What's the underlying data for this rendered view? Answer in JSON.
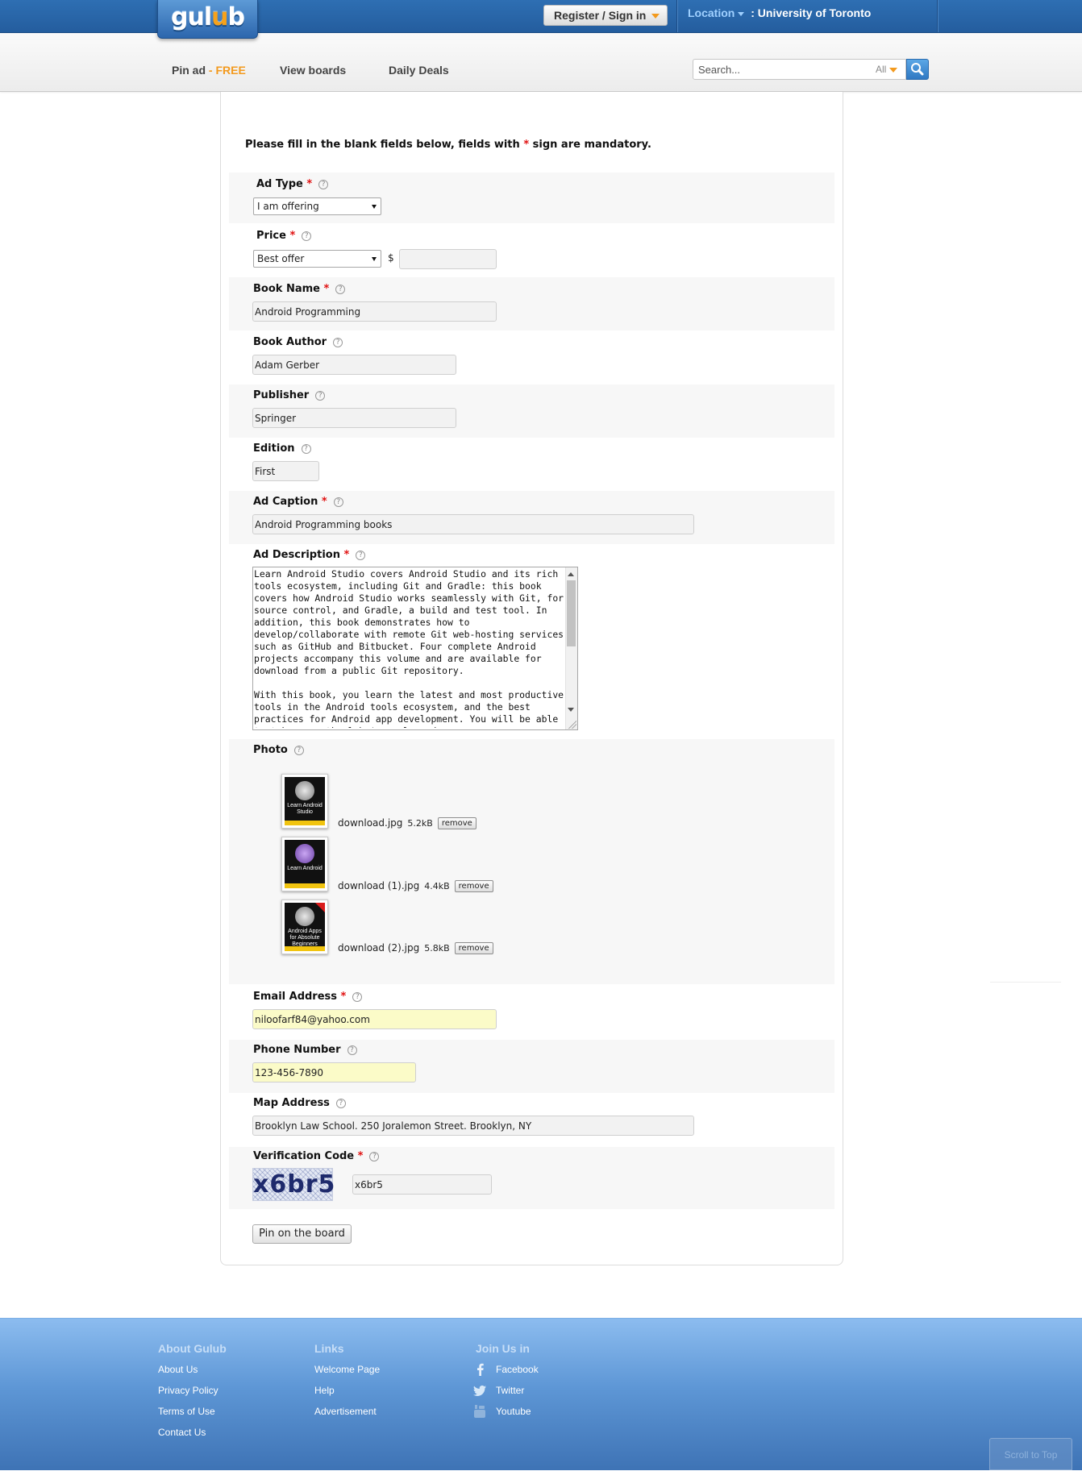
{
  "header": {
    "logo": "gulub",
    "register_label": "Register / Sign in",
    "location_label": "Location",
    "location_value": ": University of Toronto"
  },
  "nav": {
    "pin_ad": "Pin ad",
    "pin_ad_sep": " - ",
    "pin_ad_free": "FREE",
    "view_boards": "View boards",
    "daily_deals": "Daily Deals",
    "search_placeholder": "Search...",
    "search_scope": "All"
  },
  "form": {
    "intro_pre": "Please fill in the blank fields below, fields with ",
    "intro_star": "*",
    "intro_post": " sign are mandatory.",
    "required_mark": "*",
    "help_mark": "?",
    "ad_type": {
      "label": "Ad Type",
      "value": "I am offering"
    },
    "price": {
      "label": "Price",
      "value": "Best offer",
      "currency": "$",
      "amount": ""
    },
    "book_name": {
      "label": "Book Name",
      "value": "Android Programming"
    },
    "book_author": {
      "label": "Book Author",
      "value": "Adam Gerber"
    },
    "publisher": {
      "label": "Publisher",
      "value": "Springer"
    },
    "edition": {
      "label": "Edition",
      "value": "First"
    },
    "ad_caption": {
      "label": "Ad Caption",
      "value": "Android Programming books"
    },
    "ad_description": {
      "label": "Ad Description",
      "value": "Learn Android Studio covers Android Studio and its rich tools ecosystem, including Git and Gradle: this book covers how Android Studio works seamlessly with Git, for source control, and Gradle, a build and test tool. In addition, this book demonstrates how to develop/collaborate with remote Git web-hosting services such as GitHub and Bitbucket. Four complete Android projects accompany this volume and are available for download from a public Git repository.\n\nWith this book, you learn the latest and most productive tools in the Android tools ecosystem, and the best practices for Android app development. You will be able to take away the labs' sample code"
    },
    "photo": {
      "label": "Photo",
      "remove_label": "remove",
      "files": [
        {
          "name": "download.jpg",
          "size": "5.2kB",
          "cover_title": "Learn Android Studio"
        },
        {
          "name": "download (1).jpg",
          "size": "4.4kB",
          "cover_title": "Learn Android"
        },
        {
          "name": "download (2).jpg",
          "size": "5.8kB",
          "cover_title": "Android Apps for Absolute Beginners"
        }
      ]
    },
    "email": {
      "label": "Email Address",
      "value": "niloofarf84@yahoo.com"
    },
    "phone": {
      "label": "Phone Number",
      "value": "123-456-7890"
    },
    "map_address": {
      "label": "Map Address",
      "value": "Brooklyn Law School. 250 Joralemon Street. Brooklyn, NY"
    },
    "verification": {
      "label": "Verification Code",
      "captcha": "x6br5",
      "value": "x6br5"
    },
    "submit_label": "Pin on the board"
  },
  "footer": {
    "about": {
      "heading": "About Gulub",
      "links": [
        "About Us",
        "Privacy Policy",
        "Terms of Use",
        "Contact Us"
      ]
    },
    "links": {
      "heading": "Links",
      "links": [
        "Welcome Page",
        "Help",
        "Advertisement"
      ]
    },
    "join": {
      "heading": "Join Us in",
      "links": [
        "Facebook",
        "Twitter",
        "Youtube"
      ]
    },
    "scroll_top": "Scroll to Top"
  },
  "colors": {
    "brand_blue": "#245d9e",
    "accent_orange": "#f39a1e",
    "required_red": "#e01010",
    "autofill_yellow": "#fbfbc8"
  }
}
